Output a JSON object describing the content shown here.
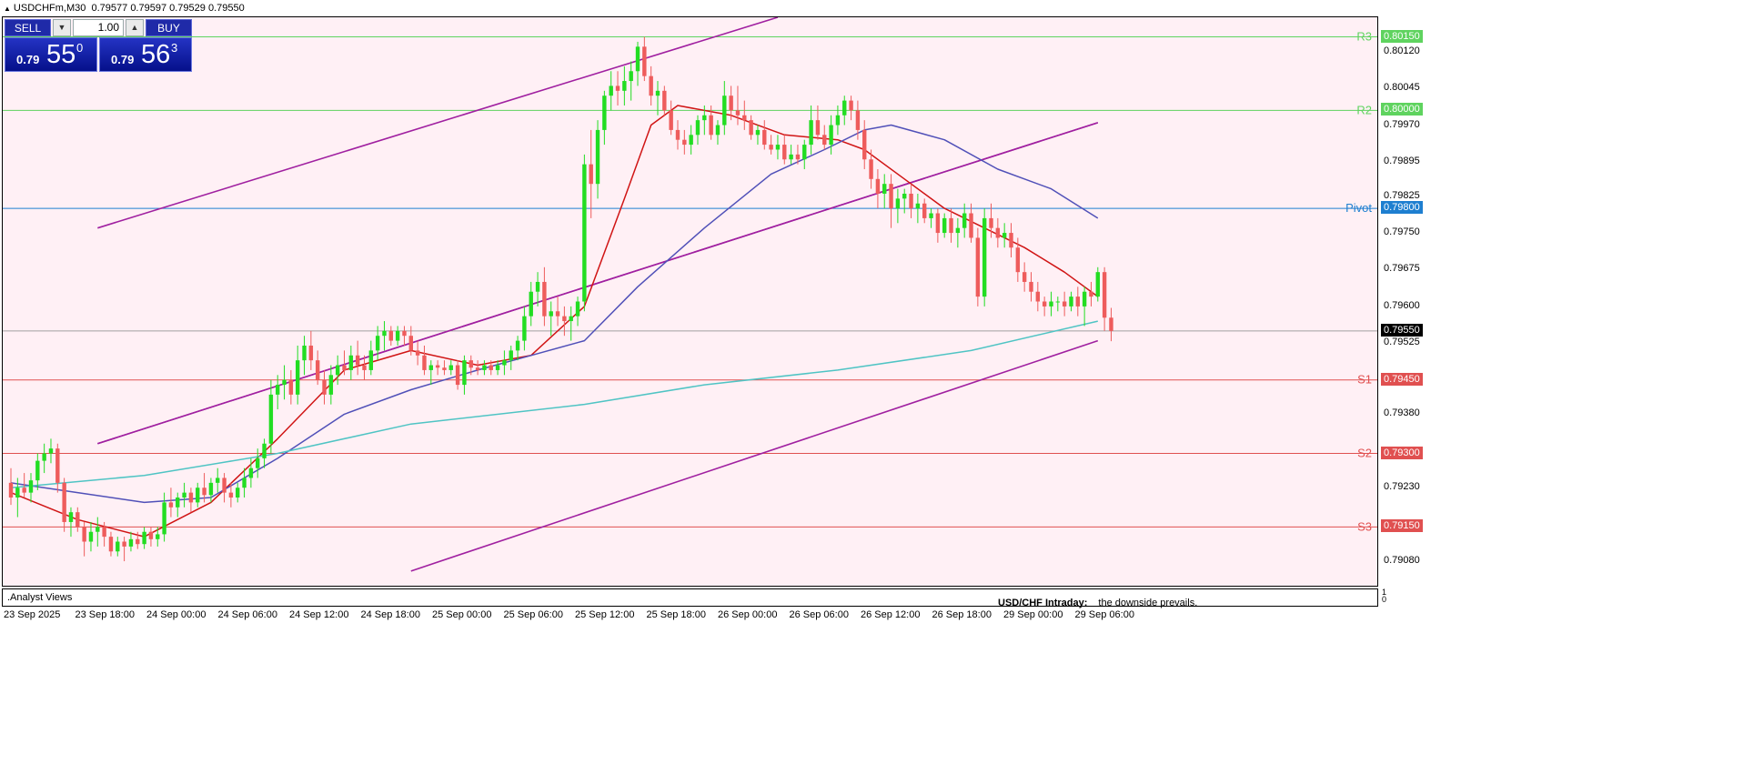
{
  "header": {
    "symbol": "USDCHFm,M30",
    "ohlc": "0.79577 0.79597 0.79529 0.79550"
  },
  "trade_panel": {
    "sell_label": "SELL",
    "buy_label": "BUY",
    "lot": "1.00",
    "sell_price_small": "0.79",
    "sell_price_big": "55",
    "sell_price_sup": "0",
    "buy_price_small": "0.79",
    "buy_price_big": "56",
    "buy_price_sup": "3"
  },
  "indicator": {
    "label": ".Analyst Views",
    "title": "USD/CHF Intraday:",
    "comment": "the downside prevails.",
    "scale_top": "1",
    "scale_bottom": "0"
  },
  "price_axis": {
    "ticks": [
      "0.80120",
      "0.80045",
      "0.79970",
      "0.79895",
      "0.79825",
      "0.79750",
      "0.79675",
      "0.79600",
      "0.79525",
      "0.79380",
      "0.79230",
      "0.79080"
    ]
  },
  "levels": [
    {
      "name": "R3",
      "price": 0.8015,
      "price_label": "0.80150",
      "color": "#5fd35f"
    },
    {
      "name": "R2",
      "price": 0.8,
      "price_label": "0.80000",
      "color": "#5fd35f"
    },
    {
      "name": "Pivot",
      "price": 0.798,
      "price_label": "0.79800",
      "color": "#1e7fd0"
    },
    {
      "name": "S1",
      "price": 0.7945,
      "price_label": "0.79450",
      "color": "#e05050"
    },
    {
      "name": "S2",
      "price": 0.793,
      "price_label": "0.79300",
      "color": "#e05050"
    },
    {
      "name": "S3",
      "price": 0.7915,
      "price_label": "0.79150",
      "color": "#e05050"
    }
  ],
  "current_price": {
    "price": 0.7955,
    "label": "0.79550"
  },
  "time_axis": {
    "labels": [
      "23 Sep 2025",
      "23 Sep 18:00",
      "24 Sep 00:00",
      "24 Sep 06:00",
      "24 Sep 12:00",
      "24 Sep 18:00",
      "25 Sep 00:00",
      "25 Sep 06:00",
      "25 Sep 12:00",
      "25 Sep 18:00",
      "26 Sep 00:00",
      "26 Sep 06:00",
      "26 Sep 12:00",
      "26 Sep 18:00",
      "29 Sep 00:00",
      "29 Sep 06:00"
    ]
  },
  "colors": {
    "bull": "#22dd22",
    "bear": "#ee5c5c",
    "ma_fast": "#d01414",
    "ma_mid": "#5050b8",
    "ma_slow": "#4fc4c4",
    "channel": "#a020a0",
    "background": "#fff0f5"
  },
  "chart_data": {
    "type": "candlestick",
    "symbol": "USDCHFm",
    "timeframe": "M30",
    "ylim": [
      0.7903,
      0.8019
    ],
    "candles": [
      [
        0.7924,
        0.7927,
        0.79195,
        0.7921
      ],
      [
        0.7921,
        0.7925,
        0.7917,
        0.7923
      ],
      [
        0.7923,
        0.7926,
        0.7921,
        0.7922
      ],
      [
        0.7922,
        0.7926,
        0.792,
        0.79245
      ],
      [
        0.79245,
        0.793,
        0.79225,
        0.79285
      ],
      [
        0.79285,
        0.7932,
        0.7926,
        0.793
      ],
      [
        0.793,
        0.7933,
        0.7928,
        0.7931
      ],
      [
        0.7931,
        0.7932,
        0.7922,
        0.7924
      ],
      [
        0.7924,
        0.7925,
        0.7914,
        0.7916
      ],
      [
        0.7916,
        0.7919,
        0.7913,
        0.7918
      ],
      [
        0.7918,
        0.7919,
        0.7914,
        0.7915
      ],
      [
        0.7915,
        0.7916,
        0.7909,
        0.7912
      ],
      [
        0.7912,
        0.7916,
        0.791,
        0.7914
      ],
      [
        0.7914,
        0.7917,
        0.7911,
        0.7915
      ],
      [
        0.7915,
        0.7916,
        0.7911,
        0.7913
      ],
      [
        0.7913,
        0.7914,
        0.7909,
        0.791
      ],
      [
        0.791,
        0.7913,
        0.7909,
        0.7912
      ],
      [
        0.7912,
        0.7913,
        0.7908,
        0.7911
      ],
      [
        0.7911,
        0.7914,
        0.791,
        0.79125
      ],
      [
        0.79125,
        0.7914,
        0.79105,
        0.79115
      ],
      [
        0.79115,
        0.7915,
        0.79105,
        0.7914
      ],
      [
        0.7914,
        0.7915,
        0.7911,
        0.79125
      ],
      [
        0.79125,
        0.7915,
        0.7911,
        0.79135
      ],
      [
        0.79135,
        0.7922,
        0.7912,
        0.792
      ],
      [
        0.792,
        0.7923,
        0.7917,
        0.7919
      ],
      [
        0.7919,
        0.7922,
        0.7917,
        0.7921
      ],
      [
        0.7921,
        0.7924,
        0.7919,
        0.7922
      ],
      [
        0.7922,
        0.7923,
        0.7918,
        0.792
      ],
      [
        0.792,
        0.7924,
        0.7919,
        0.7923
      ],
      [
        0.7923,
        0.7926,
        0.792,
        0.79215
      ],
      [
        0.79215,
        0.7925,
        0.792,
        0.7924
      ],
      [
        0.7924,
        0.7927,
        0.7922,
        0.7925
      ],
      [
        0.7925,
        0.7926,
        0.792,
        0.7922
      ],
      [
        0.7922,
        0.7924,
        0.7919,
        0.7921
      ],
      [
        0.7921,
        0.7924,
        0.792,
        0.7923
      ],
      [
        0.7923,
        0.7927,
        0.7921,
        0.7925
      ],
      [
        0.7925,
        0.7929,
        0.7923,
        0.7927
      ],
      [
        0.7927,
        0.7931,
        0.7925,
        0.7929
      ],
      [
        0.7929,
        0.7933,
        0.7927,
        0.7932
      ],
      [
        0.7932,
        0.7945,
        0.793,
        0.7942
      ],
      [
        0.7942,
        0.7946,
        0.7939,
        0.7944
      ],
      [
        0.7944,
        0.7948,
        0.7941,
        0.7945
      ],
      [
        0.7945,
        0.7947,
        0.794,
        0.7942
      ],
      [
        0.7942,
        0.7952,
        0.794,
        0.7949
      ],
      [
        0.7949,
        0.7954,
        0.7946,
        0.7952
      ],
      [
        0.7952,
        0.7955,
        0.7947,
        0.7949
      ],
      [
        0.7949,
        0.7951,
        0.7944,
        0.7945
      ],
      [
        0.7945,
        0.7947,
        0.794,
        0.7942
      ],
      [
        0.7942,
        0.7948,
        0.794,
        0.7946
      ],
      [
        0.7946,
        0.795,
        0.7944,
        0.7948
      ],
      [
        0.7948,
        0.7951,
        0.7946,
        0.7947
      ],
      [
        0.7947,
        0.7952,
        0.7945,
        0.795
      ],
      [
        0.795,
        0.7953,
        0.7946,
        0.7948
      ],
      [
        0.7948,
        0.795,
        0.7945,
        0.7947
      ],
      [
        0.7947,
        0.7953,
        0.7946,
        0.7951
      ],
      [
        0.7951,
        0.7956,
        0.7949,
        0.7954
      ],
      [
        0.7954,
        0.7957,
        0.7951,
        0.7955
      ],
      [
        0.7955,
        0.7956,
        0.7952,
        0.7953
      ],
      [
        0.7953,
        0.7956,
        0.7952,
        0.7955
      ],
      [
        0.7955,
        0.7956,
        0.7952,
        0.7954
      ],
      [
        0.7954,
        0.7956,
        0.795,
        0.7951
      ],
      [
        0.7951,
        0.7953,
        0.7948,
        0.795
      ],
      [
        0.795,
        0.7952,
        0.7946,
        0.7947
      ],
      [
        0.7947,
        0.7949,
        0.7944,
        0.7948
      ],
      [
        0.7948,
        0.7949,
        0.7946,
        0.79475
      ],
      [
        0.79475,
        0.7949,
        0.7946,
        0.7947
      ],
      [
        0.7947,
        0.7949,
        0.7946,
        0.7948
      ],
      [
        0.7948,
        0.7949,
        0.7943,
        0.7944
      ],
      [
        0.7944,
        0.795,
        0.7942,
        0.7949
      ],
      [
        0.7949,
        0.795,
        0.7946,
        0.79475
      ],
      [
        0.79475,
        0.7949,
        0.7946,
        0.7947
      ],
      [
        0.7947,
        0.7949,
        0.7946,
        0.7948
      ],
      [
        0.7948,
        0.7949,
        0.7946,
        0.7947
      ],
      [
        0.7947,
        0.7949,
        0.7946,
        0.7948
      ],
      [
        0.7948,
        0.7951,
        0.7946,
        0.7949
      ],
      [
        0.7949,
        0.7952,
        0.7947,
        0.7951
      ],
      [
        0.7951,
        0.7954,
        0.7949,
        0.7953
      ],
      [
        0.7953,
        0.796,
        0.7951,
        0.7958
      ],
      [
        0.7958,
        0.7965,
        0.7956,
        0.7963
      ],
      [
        0.7963,
        0.7967,
        0.796,
        0.7965
      ],
      [
        0.7965,
        0.7968,
        0.7956,
        0.7958
      ],
      [
        0.7958,
        0.7961,
        0.7954,
        0.7959
      ],
      [
        0.7959,
        0.7962,
        0.7956,
        0.7958
      ],
      [
        0.7958,
        0.796,
        0.7954,
        0.7957
      ],
      [
        0.7957,
        0.796,
        0.7953,
        0.7958
      ],
      [
        0.7958,
        0.7962,
        0.7956,
        0.7961
      ],
      [
        0.7961,
        0.7991,
        0.7959,
        0.7989
      ],
      [
        0.7989,
        0.7996,
        0.7978,
        0.7985
      ],
      [
        0.7985,
        0.7998,
        0.7982,
        0.7996
      ],
      [
        0.7996,
        0.8004,
        0.7993,
        0.8003
      ],
      [
        0.8003,
        0.8008,
        0.8,
        0.8005
      ],
      [
        0.8005,
        0.8008,
        0.8001,
        0.8004
      ],
      [
        0.8004,
        0.8009,
        0.8001,
        0.8006
      ],
      [
        0.8006,
        0.801,
        0.8002,
        0.8008
      ],
      [
        0.8008,
        0.8014,
        0.8005,
        0.8013
      ],
      [
        0.8013,
        0.8015,
        0.8006,
        0.8007
      ],
      [
        0.8007,
        0.8009,
        0.8001,
        0.8003
      ],
      [
        0.8003,
        0.8006,
        0.7999,
        0.8004
      ],
      [
        0.8004,
        0.8005,
        0.7999,
        0.8
      ],
      [
        0.8,
        0.8002,
        0.7995,
        0.7996
      ],
      [
        0.7996,
        0.7998,
        0.7992,
        0.7994
      ],
      [
        0.7994,
        0.7996,
        0.7991,
        0.7993
      ],
      [
        0.7993,
        0.7997,
        0.7991,
        0.7995
      ],
      [
        0.7995,
        0.7999,
        0.7993,
        0.7998
      ],
      [
        0.7998,
        0.8001,
        0.7995,
        0.7999
      ],
      [
        0.7999,
        0.8001,
        0.7994,
        0.7995
      ],
      [
        0.7995,
        0.7998,
        0.7993,
        0.7997
      ],
      [
        0.7997,
        0.8006,
        0.7995,
        0.8003
      ],
      [
        0.8003,
        0.8005,
        0.7998,
        0.8
      ],
      [
        0.8,
        0.8005,
        0.7997,
        0.7999
      ],
      [
        0.7999,
        0.8002,
        0.7996,
        0.7998
      ],
      [
        0.7998,
        0.7999,
        0.7994,
        0.7995
      ],
      [
        0.7995,
        0.7997,
        0.7993,
        0.7996
      ],
      [
        0.7996,
        0.7998,
        0.7992,
        0.7993
      ],
      [
        0.7993,
        0.7995,
        0.7991,
        0.7992
      ],
      [
        0.7992,
        0.7995,
        0.799,
        0.7993
      ],
      [
        0.7993,
        0.7995,
        0.7989,
        0.799
      ],
      [
        0.799,
        0.7993,
        0.7989,
        0.7991
      ],
      [
        0.7991,
        0.7993,
        0.7989,
        0.799
      ],
      [
        0.799,
        0.7994,
        0.7988,
        0.7993
      ],
      [
        0.7993,
        0.8001,
        0.7991,
        0.7998
      ],
      [
        0.7998,
        0.8001,
        0.7994,
        0.7995
      ],
      [
        0.7995,
        0.7997,
        0.7992,
        0.7993
      ],
      [
        0.7993,
        0.7999,
        0.7991,
        0.7997
      ],
      [
        0.7997,
        0.8001,
        0.7995,
        0.7999
      ],
      [
        0.7999,
        0.8003,
        0.7997,
        0.8002
      ],
      [
        0.8002,
        0.8003,
        0.7998,
        0.8
      ],
      [
        0.8,
        0.8002,
        0.7994,
        0.7996
      ],
      [
        0.7996,
        0.7998,
        0.7988,
        0.799
      ],
      [
        0.799,
        0.7992,
        0.7984,
        0.7986
      ],
      [
        0.7986,
        0.7988,
        0.798,
        0.7983
      ],
      [
        0.7983,
        0.7987,
        0.798,
        0.7985
      ],
      [
        0.7985,
        0.7987,
        0.7976,
        0.798
      ],
      [
        0.798,
        0.7984,
        0.7977,
        0.7982
      ],
      [
        0.7982,
        0.7984,
        0.7979,
        0.7983
      ],
      [
        0.7983,
        0.7985,
        0.7978,
        0.798
      ],
      [
        0.798,
        0.7983,
        0.7977,
        0.7981
      ],
      [
        0.7981,
        0.7982,
        0.7977,
        0.7978
      ],
      [
        0.7978,
        0.798,
        0.7976,
        0.7979
      ],
      [
        0.7979,
        0.798,
        0.7973,
        0.7975
      ],
      [
        0.7975,
        0.7979,
        0.7974,
        0.7978
      ],
      [
        0.7978,
        0.798,
        0.7973,
        0.7975
      ],
      [
        0.7975,
        0.7978,
        0.7972,
        0.7976
      ],
      [
        0.7976,
        0.7981,
        0.7974,
        0.7979
      ],
      [
        0.7979,
        0.7981,
        0.7973,
        0.7974
      ],
      [
        0.7974,
        0.7976,
        0.796,
        0.7962
      ],
      [
        0.7962,
        0.798,
        0.796,
        0.7978
      ],
      [
        0.7978,
        0.7981,
        0.7974,
        0.7976
      ],
      [
        0.7976,
        0.7978,
        0.7972,
        0.7974
      ],
      [
        0.7974,
        0.7977,
        0.7972,
        0.7975
      ],
      [
        0.7975,
        0.7977,
        0.797,
        0.7972
      ],
      [
        0.7972,
        0.7974,
        0.7965,
        0.7967
      ],
      [
        0.7967,
        0.7969,
        0.7963,
        0.7965
      ],
      [
        0.7965,
        0.7967,
        0.7961,
        0.7963
      ],
      [
        0.7963,
        0.7965,
        0.7959,
        0.7961
      ],
      [
        0.7961,
        0.7962,
        0.7958,
        0.796
      ],
      [
        0.796,
        0.7963,
        0.7958,
        0.7961
      ],
      [
        0.7961,
        0.7962,
        0.7959,
        0.7961
      ],
      [
        0.7961,
        0.7963,
        0.7958,
        0.796
      ],
      [
        0.796,
        0.7963,
        0.7959,
        0.7962
      ],
      [
        0.7962,
        0.7964,
        0.7958,
        0.796
      ],
      [
        0.796,
        0.7964,
        0.7956,
        0.7963
      ],
      [
        0.7963,
        0.7965,
        0.796,
        0.7962
      ],
      [
        0.7962,
        0.7968,
        0.7961,
        0.7967
      ],
      [
        0.7967,
        0.7968,
        0.7955,
        0.79577
      ],
      [
        0.79577,
        0.79597,
        0.79529,
        0.7955
      ]
    ],
    "moving_averages": [
      {
        "role": "fast",
        "values": [
          [
            0,
            0.7922
          ],
          [
            10,
            0.79165
          ],
          [
            20,
            0.7913
          ],
          [
            30,
            0.792
          ],
          [
            40,
            0.7933
          ],
          [
            50,
            0.7947
          ],
          [
            60,
            0.7951
          ],
          [
            70,
            0.7948
          ],
          [
            78,
            0.795
          ],
          [
            86,
            0.796
          ],
          [
            92,
            0.7982
          ],
          [
            96,
            0.7997
          ],
          [
            100,
            0.8001
          ],
          [
            108,
            0.7999
          ],
          [
            116,
            0.7995
          ],
          [
            124,
            0.7994
          ],
          [
            128,
            0.7992
          ],
          [
            134,
            0.7986
          ],
          [
            140,
            0.798
          ],
          [
            146,
            0.7976
          ],
          [
            152,
            0.7972
          ],
          [
            158,
            0.7967
          ],
          [
            163,
            0.7962
          ]
        ]
      },
      {
        "role": "mid",
        "values": [
          [
            0,
            0.7924
          ],
          [
            10,
            0.7922
          ],
          [
            20,
            0.792
          ],
          [
            30,
            0.7921
          ],
          [
            40,
            0.7929
          ],
          [
            50,
            0.7938
          ],
          [
            60,
            0.7943
          ],
          [
            70,
            0.7947
          ],
          [
            78,
            0.795
          ],
          [
            86,
            0.7953
          ],
          [
            94,
            0.7964
          ],
          [
            104,
            0.7976
          ],
          [
            114,
            0.7987
          ],
          [
            122,
            0.7992
          ],
          [
            128,
            0.7996
          ],
          [
            132,
            0.7997
          ],
          [
            140,
            0.7994
          ],
          [
            148,
            0.7988
          ],
          [
            156,
            0.7984
          ],
          [
            163,
            0.7978
          ]
        ]
      },
      {
        "role": "slow",
        "values": [
          [
            0,
            0.7923
          ],
          [
            20,
            0.79255
          ],
          [
            40,
            0.793
          ],
          [
            60,
            0.7936
          ],
          [
            86,
            0.794
          ],
          [
            104,
            0.7944
          ],
          [
            124,
            0.7947
          ],
          [
            144,
            0.7951
          ],
          [
            163,
            0.7957
          ]
        ]
      }
    ],
    "channels": [
      {
        "upper": [
          [
            13,
            0.7976
          ],
          [
            115,
            0.8019
          ]
        ],
        "lower": [
          [
            13,
            0.7932
          ],
          [
            163,
            0.79975
          ]
        ]
      },
      {
        "upper": [
          [
            13,
            0.7932
          ],
          [
            163,
            0.79975
          ]
        ],
        "lower": [
          [
            60,
            0.7906
          ],
          [
            163,
            0.7953
          ]
        ]
      }
    ]
  }
}
